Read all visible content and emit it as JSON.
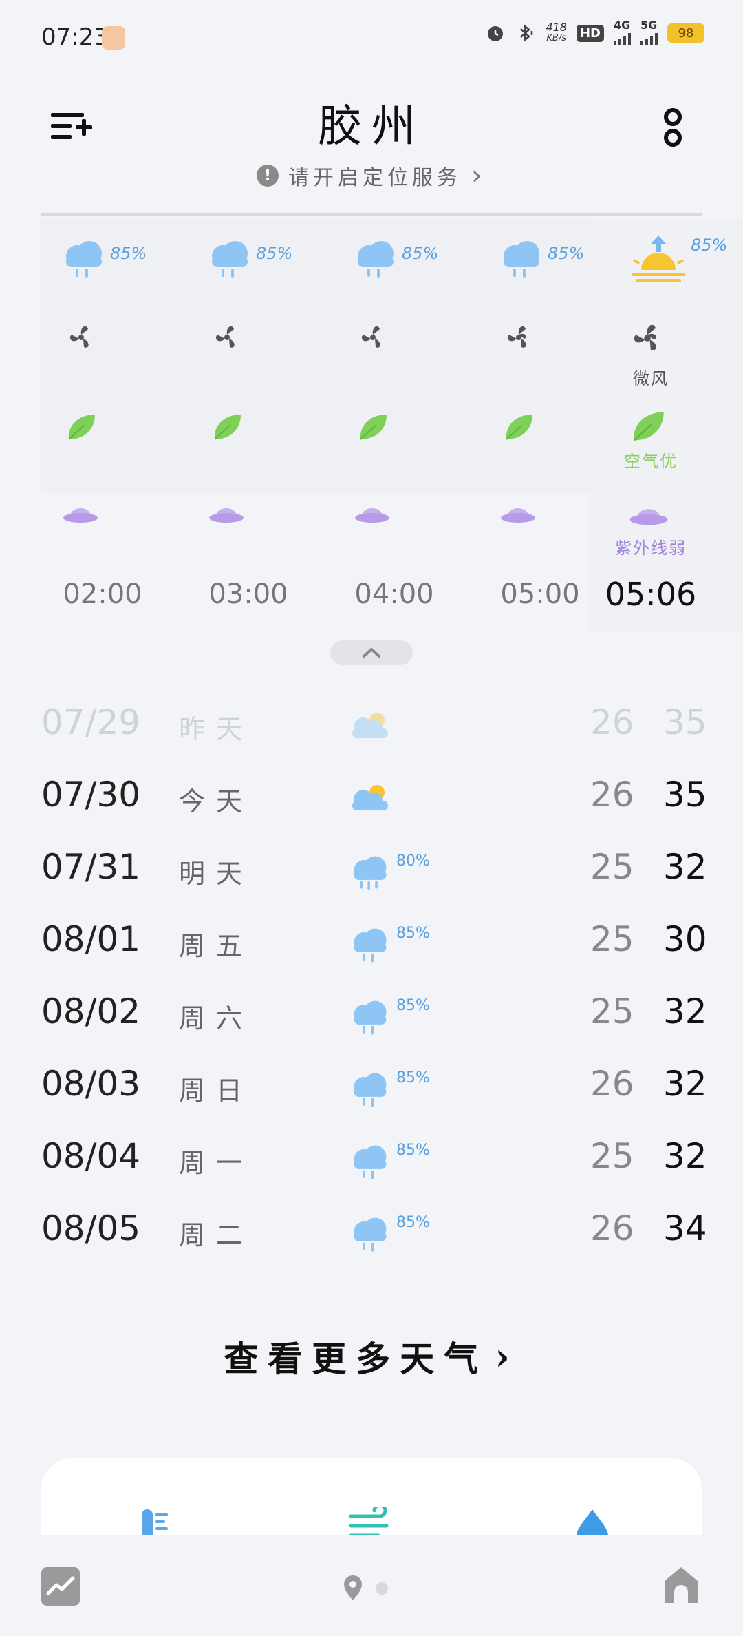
{
  "status_bar": {
    "time": "07:23",
    "net_speed_value": "418",
    "net_speed_unit": "KB/s",
    "hd_label": "HD",
    "net_4g": "4G",
    "net_5g": "5G",
    "battery": "98"
  },
  "header": {
    "city": "胶州",
    "location_tip": "请开启定位服务",
    "location_tip_arrow": "›"
  },
  "hourly": {
    "columns": [
      {
        "hour": "02:00",
        "precip": "85%"
      },
      {
        "hour": "03:00",
        "precip": "85%"
      },
      {
        "hour": "04:00",
        "precip": "85%"
      },
      {
        "hour": "05:00",
        "precip": "85%"
      },
      {
        "hour": "05:06",
        "precip": "85%",
        "wind_label": "微风",
        "air_label": "空气优",
        "uv_label": "紫外线弱"
      }
    ]
  },
  "daily": {
    "rows": [
      {
        "date": "07/29",
        "day": "昨天",
        "precip": "",
        "low": "26",
        "high": "35",
        "icon": "partly-cloudy-icon"
      },
      {
        "date": "07/30",
        "day": "今天",
        "precip": "",
        "low": "26",
        "high": "35",
        "icon": "partly-cloudy-icon"
      },
      {
        "date": "07/31",
        "day": "明天",
        "precip": "80%",
        "low": "25",
        "high": "32",
        "icon": "rain-icon"
      },
      {
        "date": "08/01",
        "day": "周五",
        "precip": "85%",
        "low": "25",
        "high": "30",
        "icon": "rain-icon"
      },
      {
        "date": "08/02",
        "day": "周六",
        "precip": "85%",
        "low": "25",
        "high": "32",
        "icon": "rain-icon"
      },
      {
        "date": "08/03",
        "day": "周日",
        "precip": "85%",
        "low": "26",
        "high": "32",
        "icon": "rain-icon"
      },
      {
        "date": "08/04",
        "day": "周一",
        "precip": "85%",
        "low": "25",
        "high": "32",
        "icon": "rain-icon"
      },
      {
        "date": "08/05",
        "day": "周二",
        "precip": "85%",
        "low": "26",
        "high": "34",
        "icon": "rain-icon"
      }
    ]
  },
  "more_weather": {
    "label": "查看更多天气",
    "arrow": "›"
  },
  "colors": {
    "rain_blue": "#8ec5f4",
    "precip_text": "#5aa0e0",
    "sun_yellow": "#f7c531",
    "leaf_green": "#7fd058",
    "uv_purple": "#b79ae8",
    "battery": "#f3c12a"
  }
}
